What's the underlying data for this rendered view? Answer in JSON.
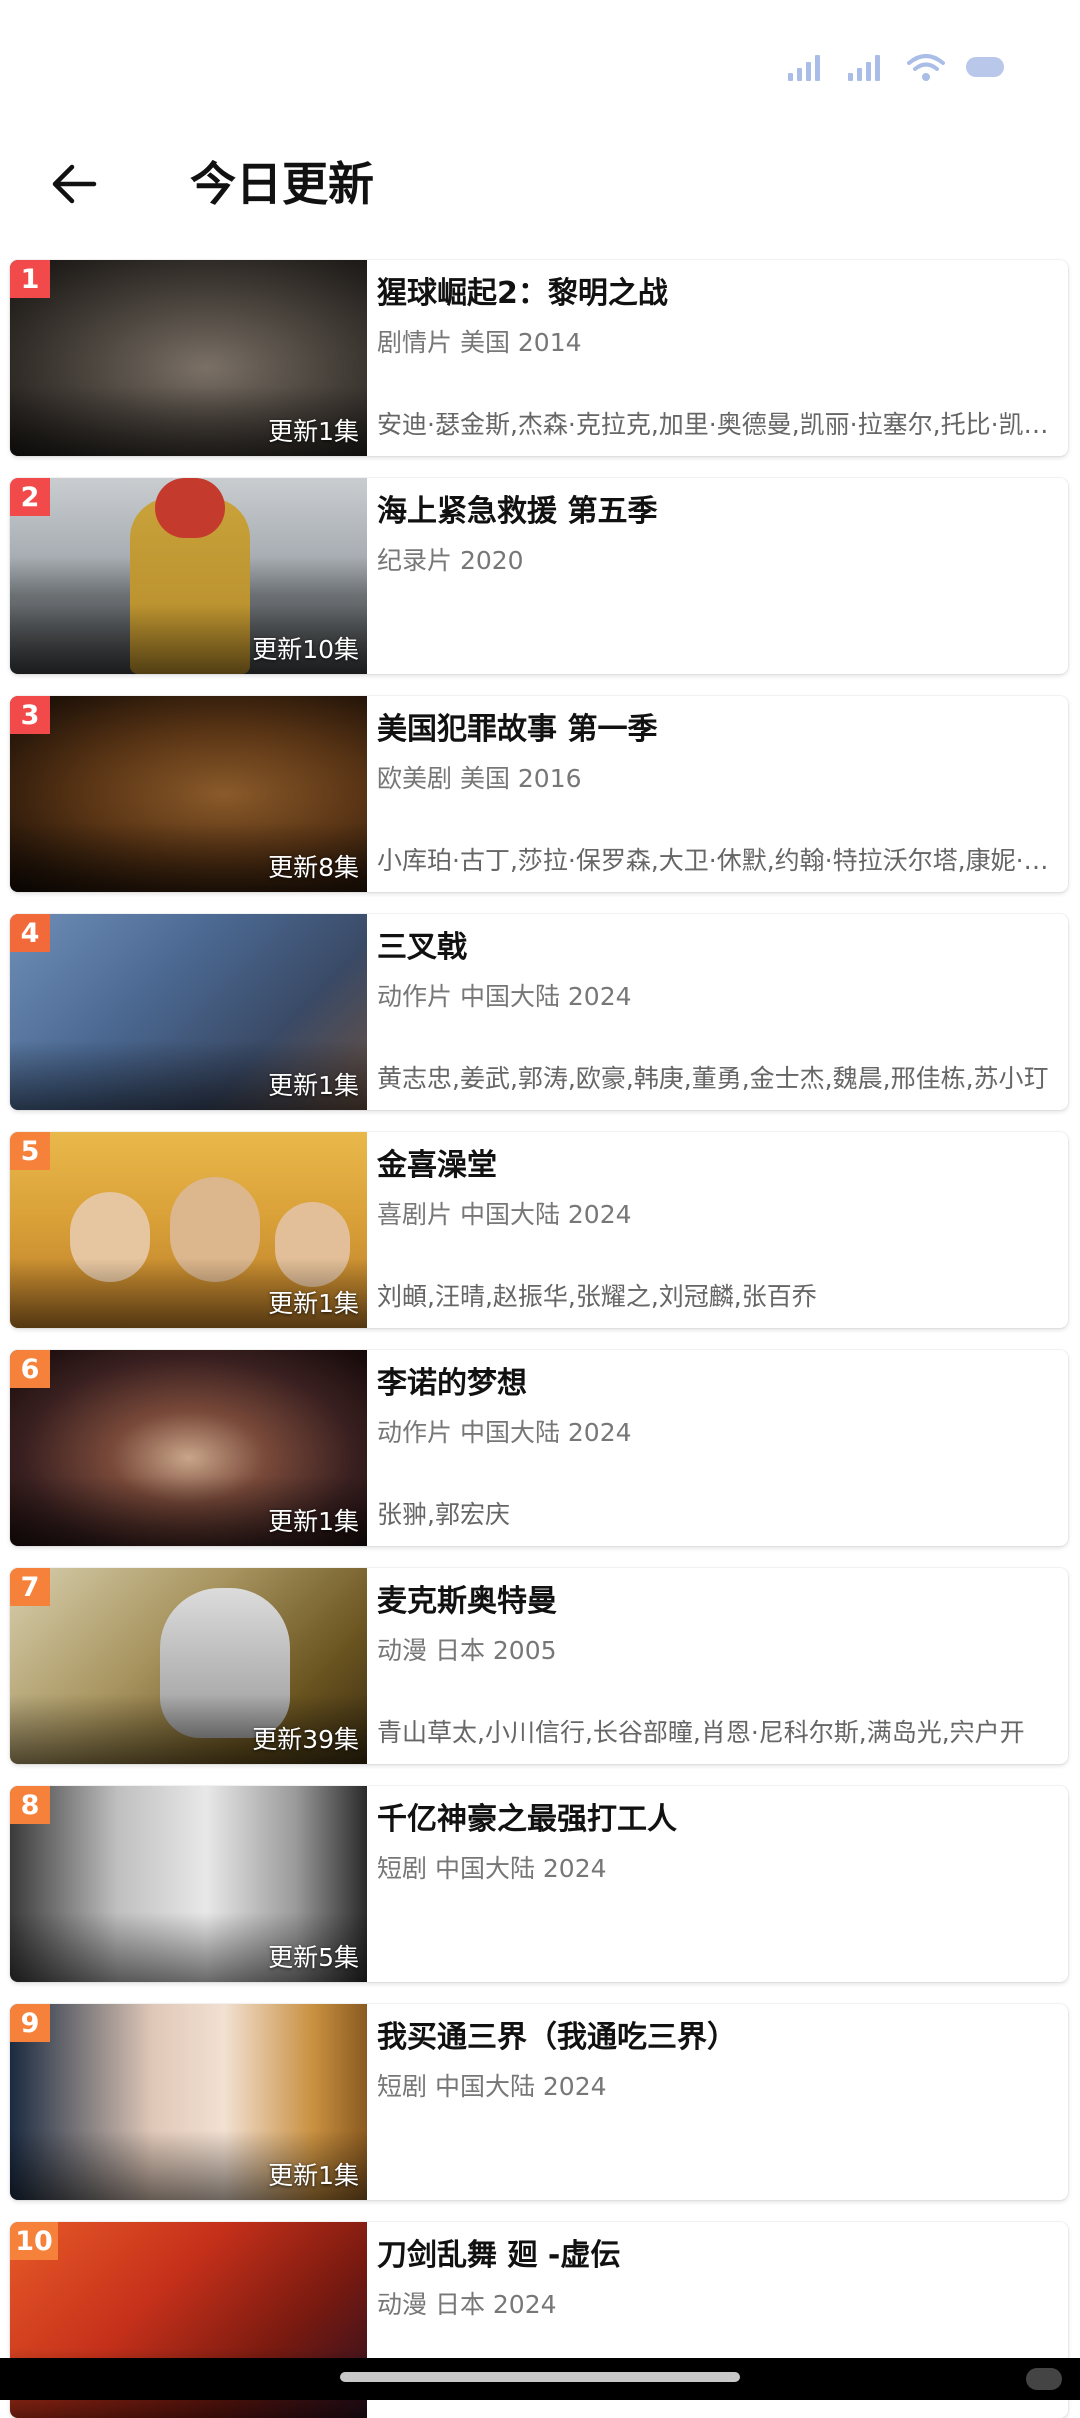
{
  "header": {
    "title": "今日更新"
  },
  "colors": {
    "rank_top": "#f24a4a",
    "rank_mid": "#f26a3a",
    "rank_low": "#f5813a",
    "status_icons": "#a9bde6"
  },
  "items": [
    {
      "rank": "1",
      "title": "猩球崛起2：黎明之战",
      "meta": "剧情片 美国 2014",
      "cast": "安迪·瑟金斯,杰森·克拉克,加里·奥德曼,凯丽·拉塞尔,托比·凯贝尔",
      "update": "更新1集"
    },
    {
      "rank": "2",
      "title": "海上紧急救援 第五季",
      "meta": "纪录片 2020",
      "cast": "",
      "update": "更新10集"
    },
    {
      "rank": "3",
      "title": "美国犯罪故事 第一季",
      "meta": "欧美剧 美国 2016",
      "cast": "小库珀·古丁,莎拉·保罗森,大卫·休默,约翰·特拉沃尔塔,康妮·布里顿",
      "update": "更新8集"
    },
    {
      "rank": "4",
      "title": "三叉戟",
      "meta": "动作片 中国大陆 2024",
      "cast": "黄志忠,姜武,郭涛,欧豪,韩庚,董勇,金士杰,魏晨,邢佳栋,苏小玎",
      "update": "更新1集"
    },
    {
      "rank": "5",
      "title": "金喜澡堂",
      "meta": "喜剧片 中国大陆 2024",
      "cast": "刘頔,汪晴,赵振华,张耀之,刘冠麟,张百乔",
      "update": "更新1集"
    },
    {
      "rank": "6",
      "title": "李诺的梦想",
      "meta": "动作片 中国大陆 2024",
      "cast": "张翀,郭宏庆",
      "update": "更新1集"
    },
    {
      "rank": "7",
      "title": "麦克斯奥特曼",
      "meta": "动漫 日本 2005",
      "cast": "青山草太,小川信行,长谷部瞳,肖恩·尼科尔斯,满岛光,宍户开",
      "update": "更新39集"
    },
    {
      "rank": "8",
      "title": "千亿神豪之最强打工人",
      "meta": "短剧 中国大陆 2024",
      "cast": "",
      "update": "更新5集"
    },
    {
      "rank": "9",
      "title": "我买通三界（我通吃三界）",
      "meta": "短剧 中国大陆 2024",
      "cast": "",
      "update": "更新1集"
    },
    {
      "rank": "10",
      "title": "刀剑乱舞 廻 -虚伝",
      "meta": "动漫 日本 2024",
      "cast": "",
      "update": ""
    }
  ]
}
